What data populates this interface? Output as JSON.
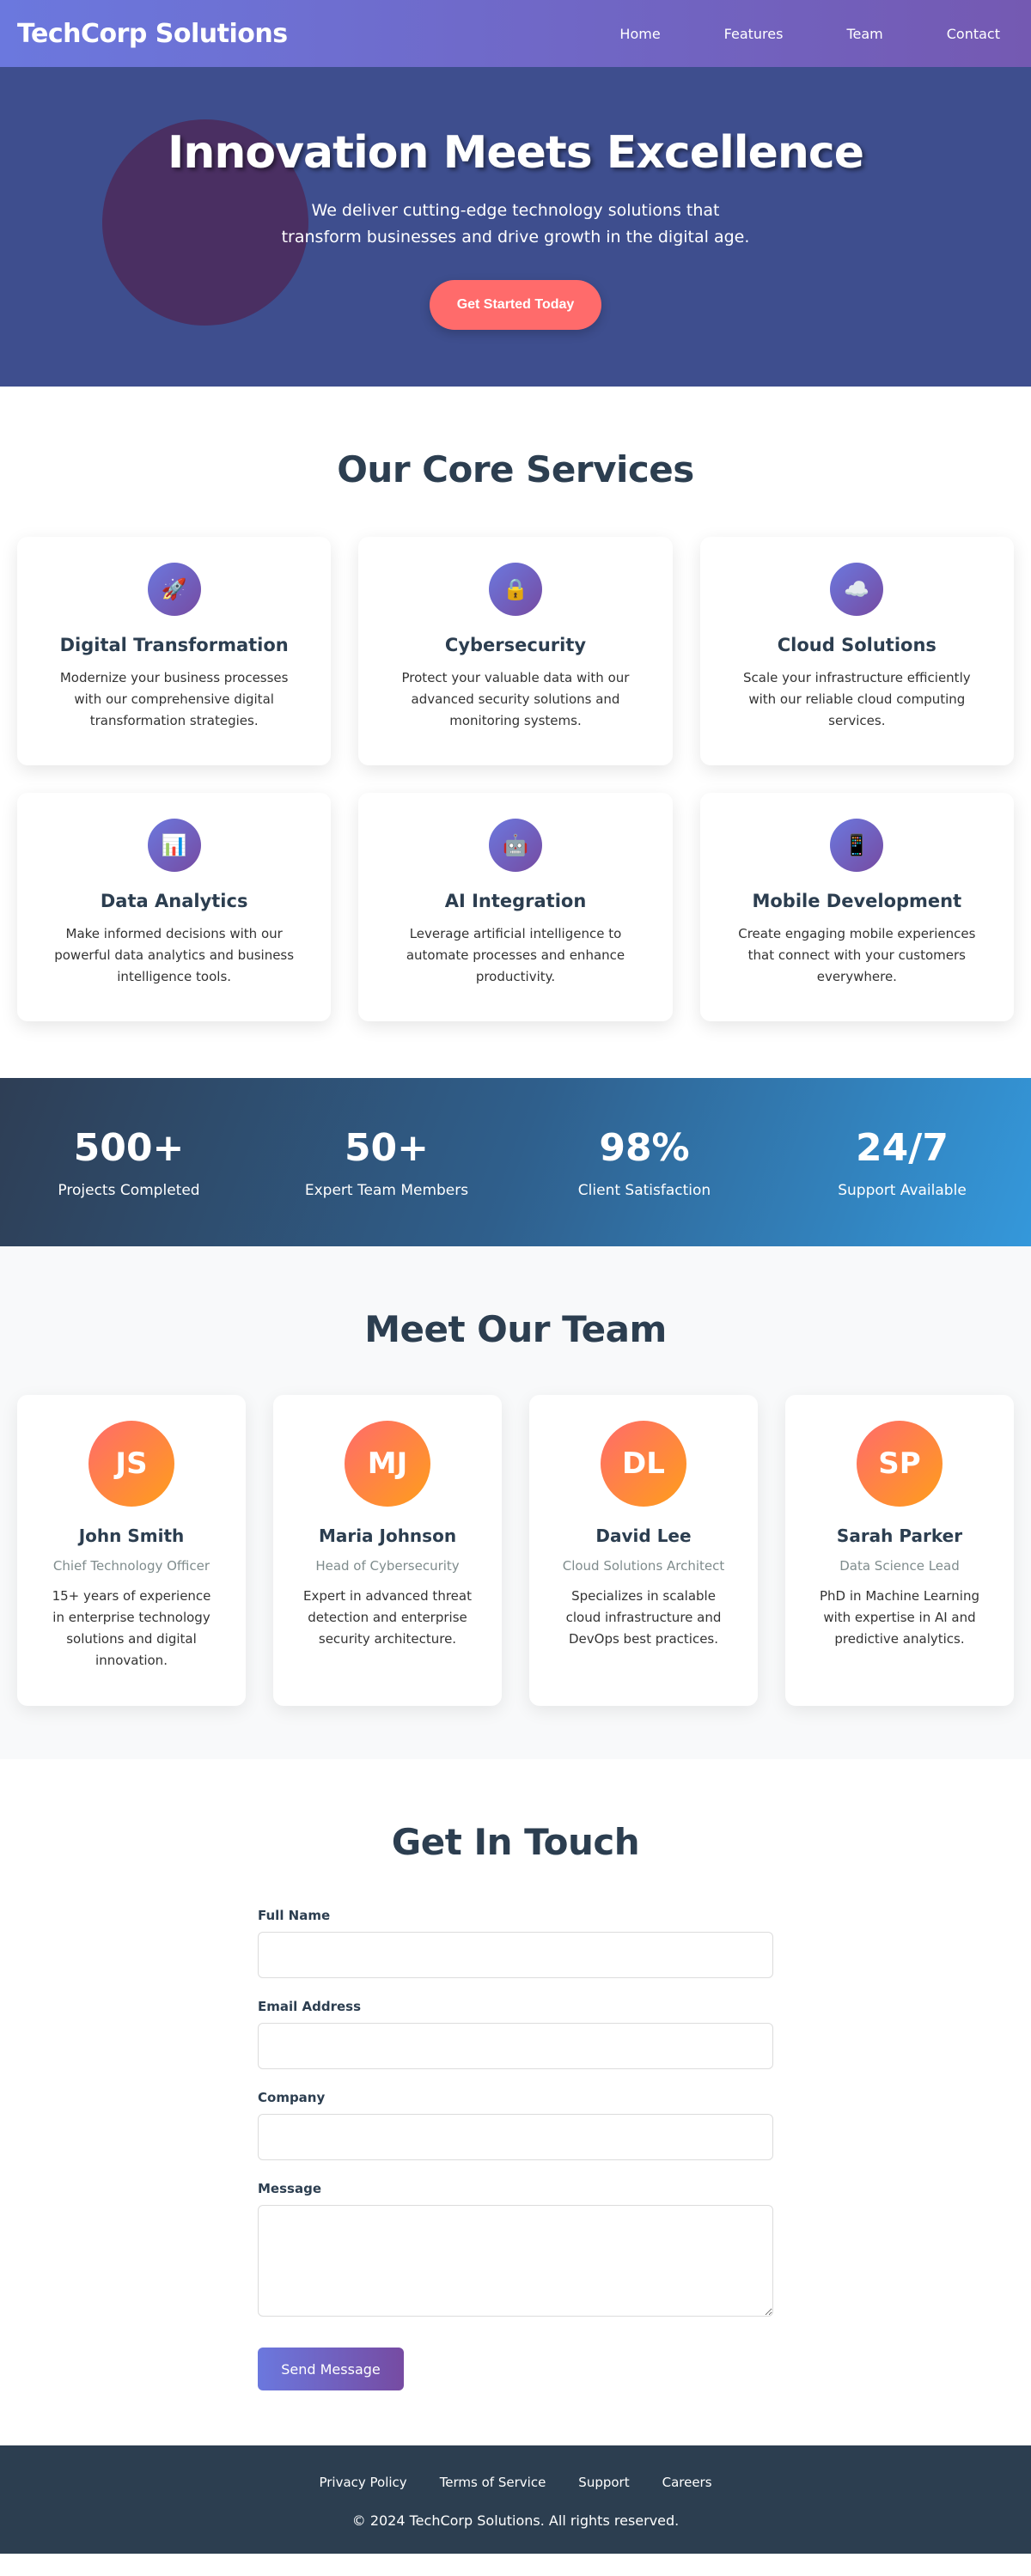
{
  "nav": {
    "brand": "TechCorp Solutions",
    "links": [
      "Home",
      "Features",
      "Team",
      "Contact"
    ]
  },
  "hero": {
    "title": "Innovation Meets Excellence",
    "subtitle": "We deliver cutting-edge technology solutions that transform businesses and drive growth in the digital age.",
    "cta": "Get Started Today"
  },
  "services": {
    "title": "Our Core Services",
    "items": [
      {
        "icon": "rocket-icon",
        "glyph": "🚀",
        "name": "Digital Transformation",
        "desc": "Modernize your business processes with our comprehensive digital transformation strategies."
      },
      {
        "icon": "lock-icon",
        "glyph": "🔒",
        "name": "Cybersecurity",
        "desc": "Protect your valuable data with our advanced security solutions and monitoring systems."
      },
      {
        "icon": "cloud-icon",
        "glyph": "☁️",
        "name": "Cloud Solutions",
        "desc": "Scale your infrastructure efficiently with our reliable cloud computing services."
      },
      {
        "icon": "chart-icon",
        "glyph": "📊",
        "name": "Data Analytics",
        "desc": "Make informed decisions with our powerful data analytics and business intelligence tools."
      },
      {
        "icon": "robot-icon",
        "glyph": "🤖",
        "name": "AI Integration",
        "desc": "Leverage artificial intelligence to automate processes and enhance productivity."
      },
      {
        "icon": "mobile-icon",
        "glyph": "📱",
        "name": "Mobile Development",
        "desc": "Create engaging mobile experiences that connect with your customers everywhere."
      }
    ]
  },
  "stats": [
    {
      "value": "500+",
      "label": "Projects Completed"
    },
    {
      "value": "50+",
      "label": "Expert Team Members"
    },
    {
      "value": "98%",
      "label": "Client Satisfaction"
    },
    {
      "value": "24/7",
      "label": "Support Available"
    }
  ],
  "team": {
    "title": "Meet Our Team",
    "members": [
      {
        "initials": "JS",
        "name": "John Smith",
        "role": "Chief Technology Officer",
        "bio": "15+ years of experience in enterprise technology solutions and digital innovation."
      },
      {
        "initials": "MJ",
        "name": "Maria Johnson",
        "role": "Head of Cybersecurity",
        "bio": "Expert in advanced threat detection and enterprise security architecture."
      },
      {
        "initials": "DL",
        "name": "David Lee",
        "role": "Cloud Solutions Architect",
        "bio": "Specializes in scalable cloud infrastructure and DevOps best practices."
      },
      {
        "initials": "SP",
        "name": "Sarah Parker",
        "role": "Data Science Lead",
        "bio": "PhD in Machine Learning with expertise in AI and predictive analytics."
      }
    ]
  },
  "contact": {
    "title": "Get In Touch",
    "fields": {
      "name_label": "Full Name",
      "email_label": "Email Address",
      "company_label": "Company",
      "message_label": "Message"
    },
    "values": {
      "name": "",
      "email": "",
      "company": "",
      "message": ""
    },
    "submit": "Send Message"
  },
  "footer": {
    "links": [
      "Privacy Policy",
      "Terms of Service",
      "Support",
      "Careers"
    ],
    "copyright": "© 2024 TechCorp Solutions. All rights reserved."
  },
  "colors": {
    "primary_gradient_start": "#6b78de",
    "primary_gradient_end": "#764ba2",
    "accent": "#ff6b6b",
    "dark": "#2c3e50"
  }
}
